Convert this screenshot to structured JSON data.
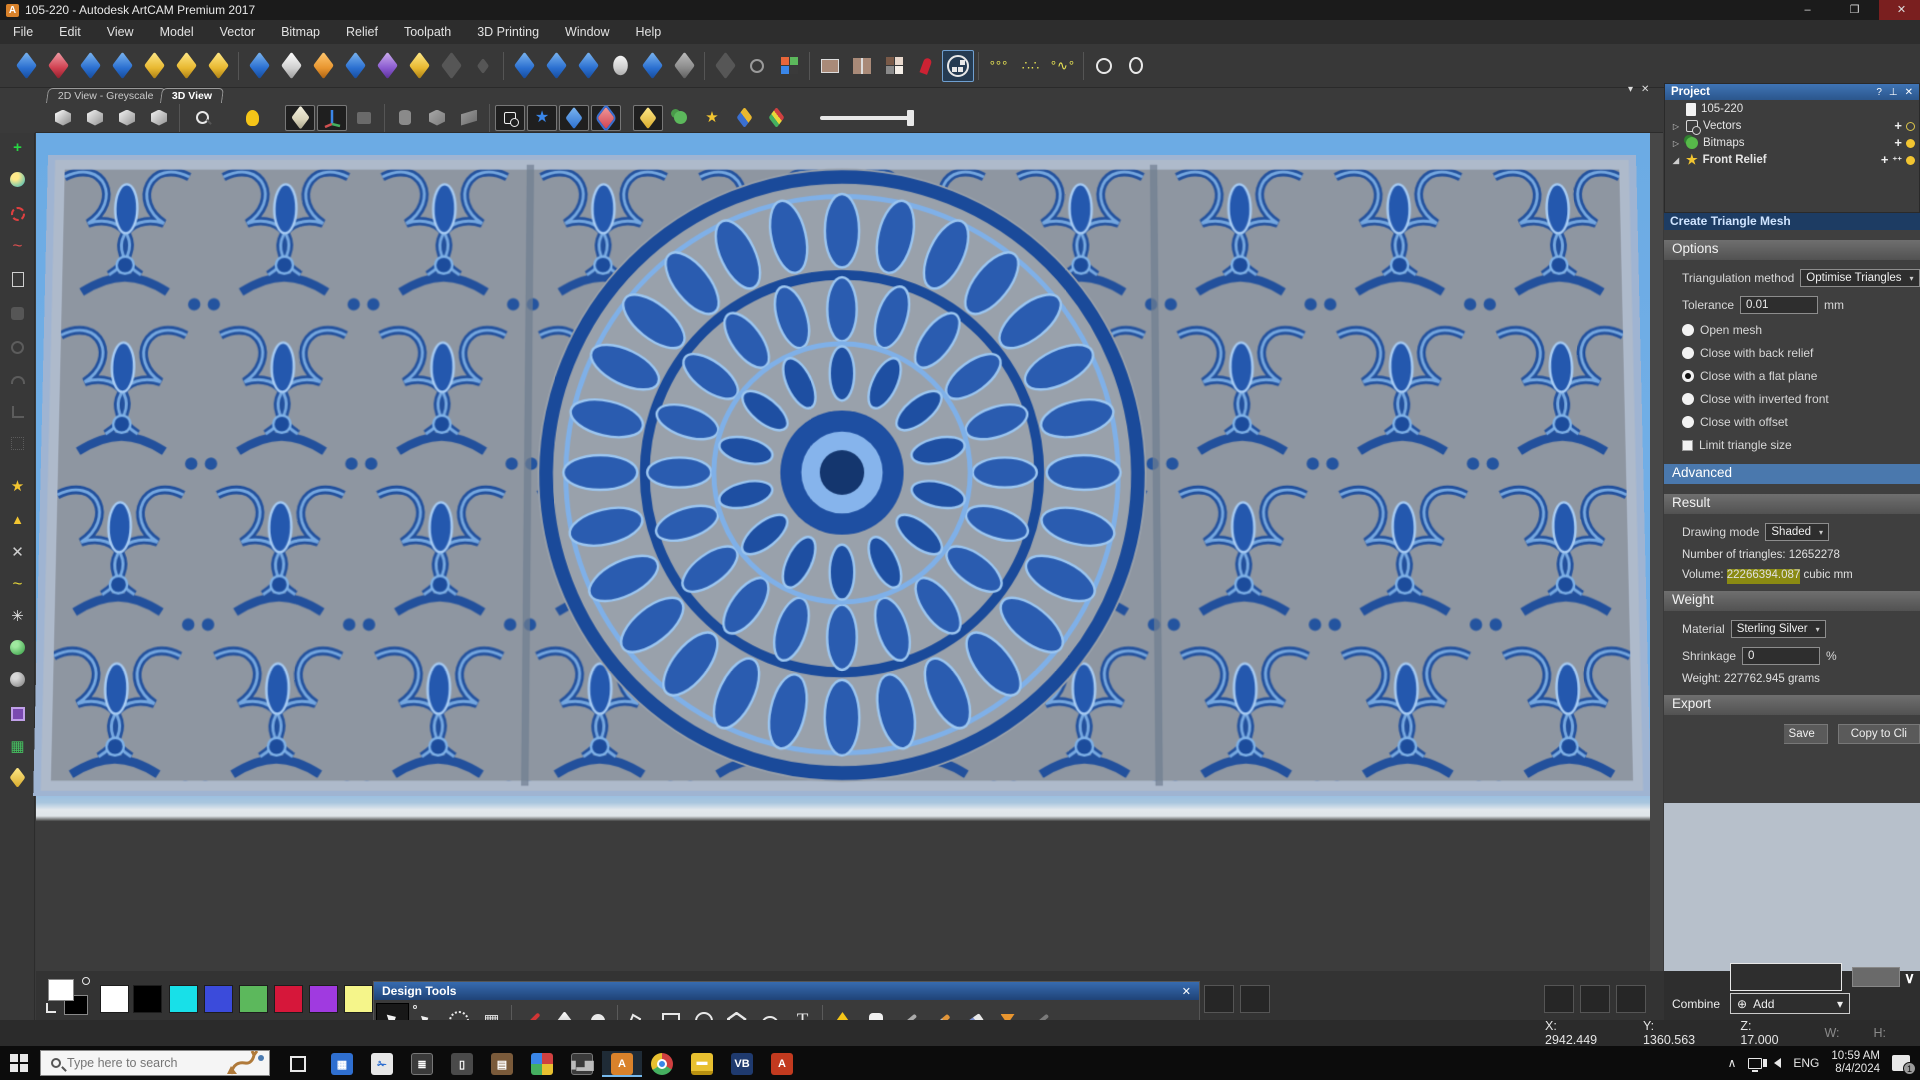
{
  "window": {
    "title": "105-220 - Autodesk ArtCAM Premium 2017"
  },
  "menu": {
    "items": [
      "File",
      "Edit",
      "View",
      "Model",
      "Vector",
      "Bitmap",
      "Relief",
      "Toolpath",
      "3D Printing",
      "Window",
      "Help"
    ]
  },
  "tabs": [
    {
      "label": "2D View - Greyscale",
      "active": false
    },
    {
      "label": "3D View",
      "active": true
    }
  ],
  "project_panel": {
    "title": "Project",
    "tree": [
      {
        "label": "105-220"
      },
      {
        "label": "Vectors"
      },
      {
        "label": "Bitmaps"
      },
      {
        "label": "Front Relief"
      }
    ]
  },
  "mesh_panel": {
    "title": "Create Triangle Mesh",
    "options_header": "Options",
    "triangulation_label": "Triangulation method",
    "triangulation_value": "Optimise Triangles",
    "tolerance_label": "Tolerance",
    "tolerance_value": "0.01",
    "tolerance_unit": "mm",
    "radios": [
      {
        "label": "Open mesh",
        "selected": false
      },
      {
        "label": "Close with back relief",
        "selected": false
      },
      {
        "label": "Close with a flat plane",
        "selected": true
      },
      {
        "label": "Close with inverted front",
        "selected": false
      },
      {
        "label": "Close with offset",
        "selected": false
      }
    ],
    "checkbox_label": "Limit triangle size",
    "advanced_label": "Advanced",
    "result_header": "Result",
    "drawing_mode_label": "Drawing mode",
    "drawing_mode_value": "Shaded",
    "triangles_label": "Number of triangles:",
    "triangles_value": "12652278",
    "volume_label": "Volume:",
    "volume_value": "22266394.087",
    "volume_unit": "cubic mm",
    "weight_header": "Weight",
    "material_label": "Material",
    "material_value": "Sterling Silver",
    "shrinkage_label": "Shrinkage",
    "shrinkage_value": "0",
    "shrinkage_unit": "%",
    "weight_label": "Weight:",
    "weight_value": "227762.945",
    "weight_unit": "grams",
    "export_header": "Export",
    "save_label": "Save",
    "copy_label": "Copy to Cli"
  },
  "design_tools": {
    "title": "Design Tools"
  },
  "combine": {
    "label": "Combine",
    "value": "Add"
  },
  "status": {
    "x": "X: 2942.449",
    "y": "Y: 1360.563",
    "z": "Z: 17.000",
    "w": "W:",
    "h": "H:"
  },
  "taskbar": {
    "search_placeholder": "Type here to search",
    "language": "ENG",
    "time": "10:59 AM",
    "date": "8/4/2024",
    "badge": "1",
    "artcam_letter": "A",
    "vb_label": "VB"
  },
  "glyphs": {
    "app_letter": "A",
    "minimize": "–",
    "maximize": "❐",
    "close": "✕",
    "help": "?",
    "pin": "⊥",
    "dropdown_caret": "▾",
    "collapsed_arrow": "▷",
    "expanded_arrow": "◢",
    "plus": "+",
    "up_arrow": "∧",
    "down_arrow": "∨",
    "chevron_down": "∨",
    "add_circle": "⊕",
    "star": "★",
    "triangle": "▲",
    "cross": "✕",
    "asterisk": "✳",
    "grid": "▦",
    "wave": "~",
    "text_tool": "T",
    "zoom_plus": "+"
  },
  "colors": {
    "accent_blue": "#3f74b5",
    "highlight_yellow": "#8a8a12",
    "canvas_blue": "#6cabe4",
    "relief_blue_dark": "#1a4a9a",
    "relief_blue_light": "#9cc6f0",
    "palette": [
      "#ffffff",
      "#000000",
      "#18e0e8",
      "#3b4bdb",
      "#5cb85c",
      "#d6173a",
      "#a03ae0",
      "#f5f58a"
    ]
  }
}
